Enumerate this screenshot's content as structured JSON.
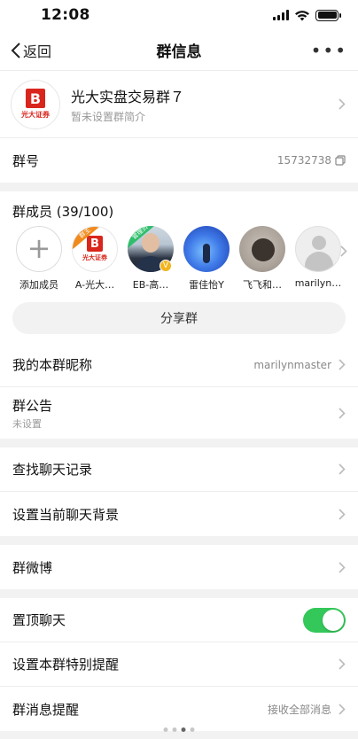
{
  "status_bar": {
    "time": "12:08"
  },
  "nav": {
    "back_label": "返回",
    "title": "群信息",
    "more_label": "•••"
  },
  "group": {
    "logo_letter": "B",
    "logo_text": "光大证券",
    "name": "光大实盘交易群７",
    "description": "暂未设置群简介"
  },
  "group_number": {
    "label": "群号",
    "value": "15732738"
  },
  "members": {
    "title": "群成员 (39/100)",
    "list": [
      {
        "name": "添加成员"
      },
      {
        "name": "A-光大…",
        "badge": "群主"
      },
      {
        "name": "EB-高…",
        "badge": "管理员"
      },
      {
        "name": "雷佳怡Y"
      },
      {
        "name": "飞飞和…"
      },
      {
        "name": "marilyn…"
      }
    ],
    "share_label": "分享群"
  },
  "nickname": {
    "label": "我的本群昵称",
    "value": "marilynmaster"
  },
  "announcement": {
    "label": "群公告",
    "value": "未设置"
  },
  "search_history": {
    "label": "查找聊天记录"
  },
  "chat_background": {
    "label": "设置当前聊天背景"
  },
  "group_weibo": {
    "label": "群微博"
  },
  "pin_chat": {
    "label": "置顶聊天",
    "enabled": true
  },
  "special_reminder": {
    "label": "设置本群特别提醒"
  },
  "message_reminder": {
    "label": "群消息提醒",
    "value": "接收全部消息"
  },
  "colors": {
    "accent_green": "#34c759",
    "brand_red": "#d9261c",
    "owner_orange": "#f08a1c"
  }
}
